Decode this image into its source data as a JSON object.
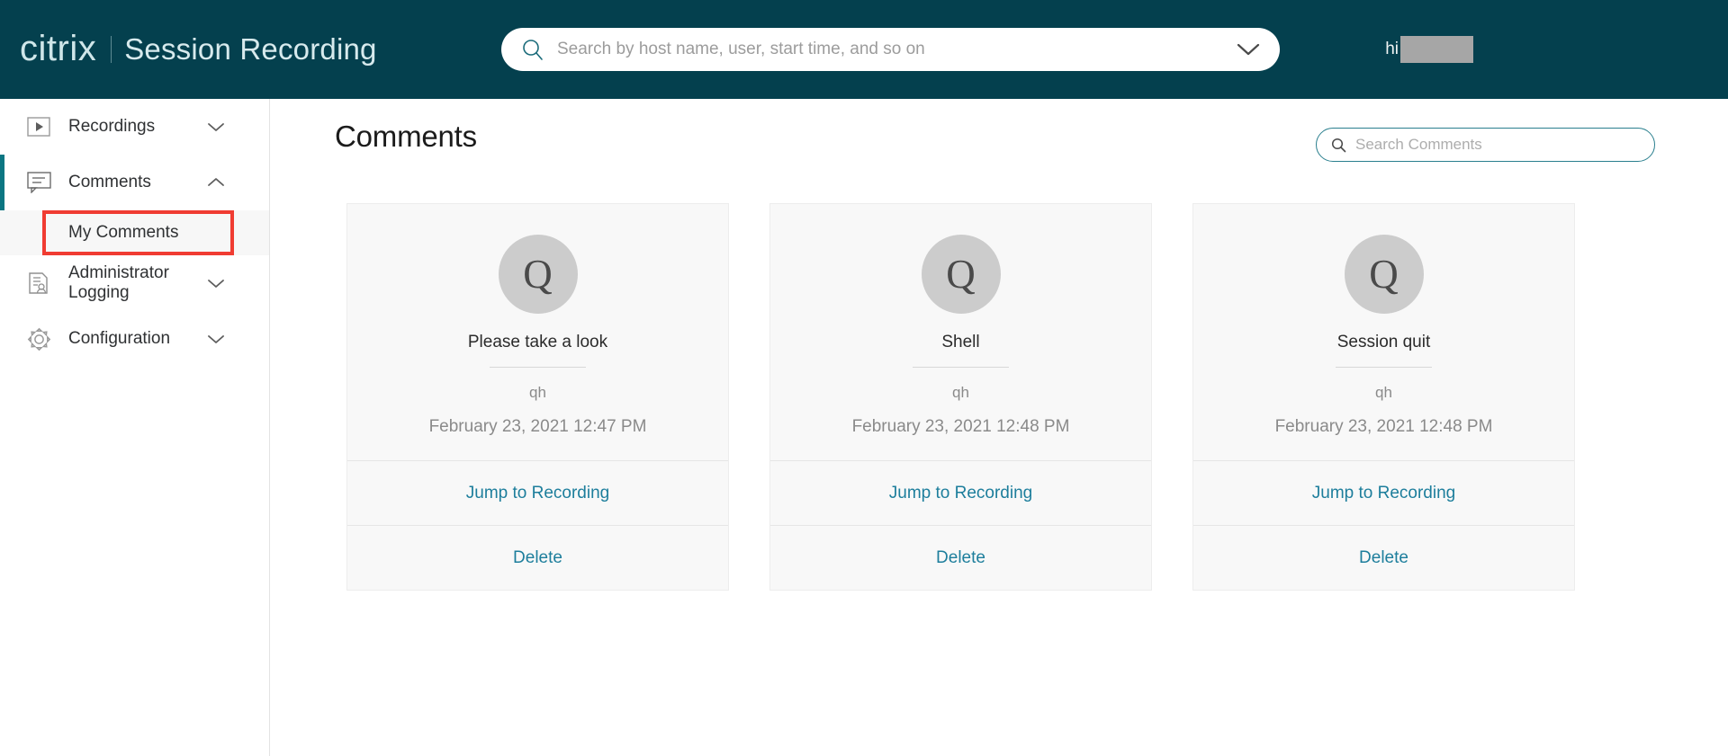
{
  "header": {
    "logo_text": "citrix",
    "product_title": "Session Recording",
    "logo_icon": "citrix-logo",
    "search": {
      "placeholder": "Search by host name, user, start time, and so on",
      "value": "",
      "icon": "search-icon",
      "expand_icon": "chevron-down-icon"
    },
    "user": {
      "greeting": "hi",
      "name_redacted": ""
    },
    "background_color": "#04404e"
  },
  "sidebar": {
    "accent_color": "#0b7682",
    "items": [
      {
        "label": "Recordings",
        "icon": "play-recording-icon",
        "chevron": "chevron-down-icon",
        "expanded": false
      },
      {
        "label": "Comments",
        "icon": "comment-bubble-icon",
        "chevron": "chevron-up-icon",
        "expanded": true
      },
      {
        "label": "Administrator Logging",
        "icon": "admin-log-icon",
        "chevron": "chevron-down-icon",
        "expanded": false
      },
      {
        "label": "Configuration",
        "icon": "gear-icon",
        "chevron": "chevron-down-icon",
        "expanded": false
      }
    ],
    "subitems": [
      {
        "label": "My Comments",
        "parent": "Comments",
        "selected": true,
        "highlight_color": "#f03c32"
      }
    ]
  },
  "main": {
    "page_title": "Comments",
    "search": {
      "placeholder": "Search Comments",
      "value": "",
      "icon": "search-icon",
      "border_color": "#2a7f8e"
    },
    "link_color": "#1d7e9c",
    "actions": {
      "jump_label": "Jump to Recording",
      "delete_label": "Delete"
    },
    "cards": [
      {
        "avatar_letter": "Q",
        "title": "Please take a look",
        "author": "qh",
        "date": "February 23, 2021 12:47 PM",
        "jump_label": "Jump to Recording",
        "delete_label": "Delete"
      },
      {
        "avatar_letter": "Q",
        "title": "Shell",
        "author": "qh",
        "date": "February 23, 2021 12:48 PM",
        "jump_label": "Jump to Recording",
        "delete_label": "Delete"
      },
      {
        "avatar_letter": "Q",
        "title": "Session quit",
        "author": "qh",
        "date": "February 23, 2021 12:48 PM",
        "jump_label": "Jump to Recording",
        "delete_label": "Delete"
      }
    ]
  }
}
